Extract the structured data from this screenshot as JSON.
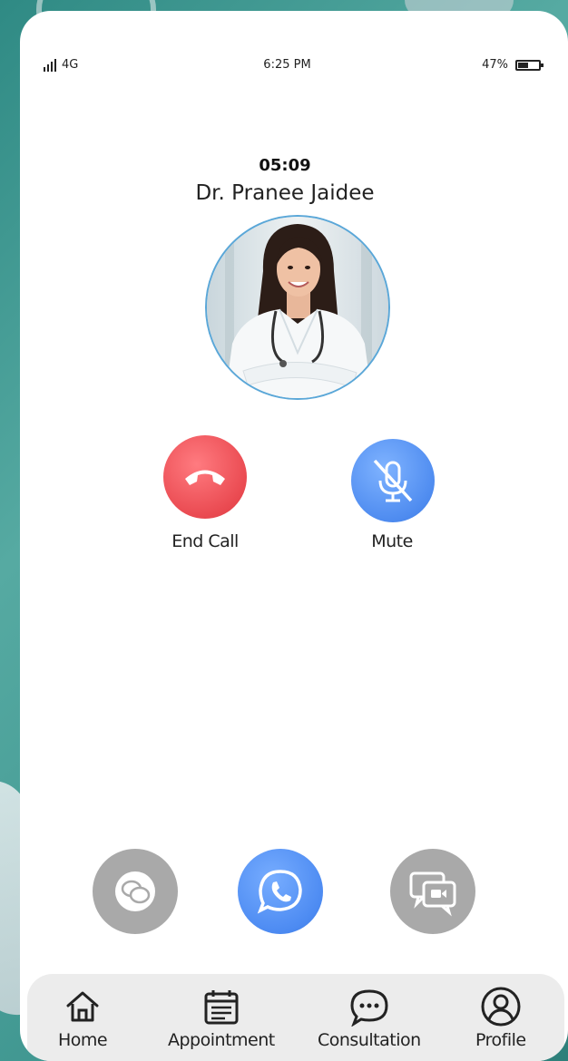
{
  "status_bar": {
    "network": "4G",
    "time": "6:25 PM",
    "battery": "47%"
  },
  "call": {
    "timer": "05:09",
    "doctor_name": "Dr. Pranee Jaidee"
  },
  "actions": {
    "end_call_label": "End Call",
    "mute_label": "Mute"
  },
  "colors": {
    "end_call": "#ea4a51",
    "mute": "#4f8cf0",
    "active_mode": "#4d8bf2",
    "inactive_mode": "#a9a9a9"
  },
  "modes": [
    {
      "icon": "chat-bubbles-icon",
      "active": false
    },
    {
      "icon": "phone-call-icon",
      "active": true
    },
    {
      "icon": "video-chat-icon",
      "active": false
    }
  ],
  "tabs": [
    {
      "label": "Home",
      "icon": "home-icon"
    },
    {
      "label": "Appointment",
      "icon": "calendar-icon"
    },
    {
      "label": "Consultation",
      "icon": "chat-icon"
    },
    {
      "label": "Profile",
      "icon": "user-icon"
    }
  ]
}
